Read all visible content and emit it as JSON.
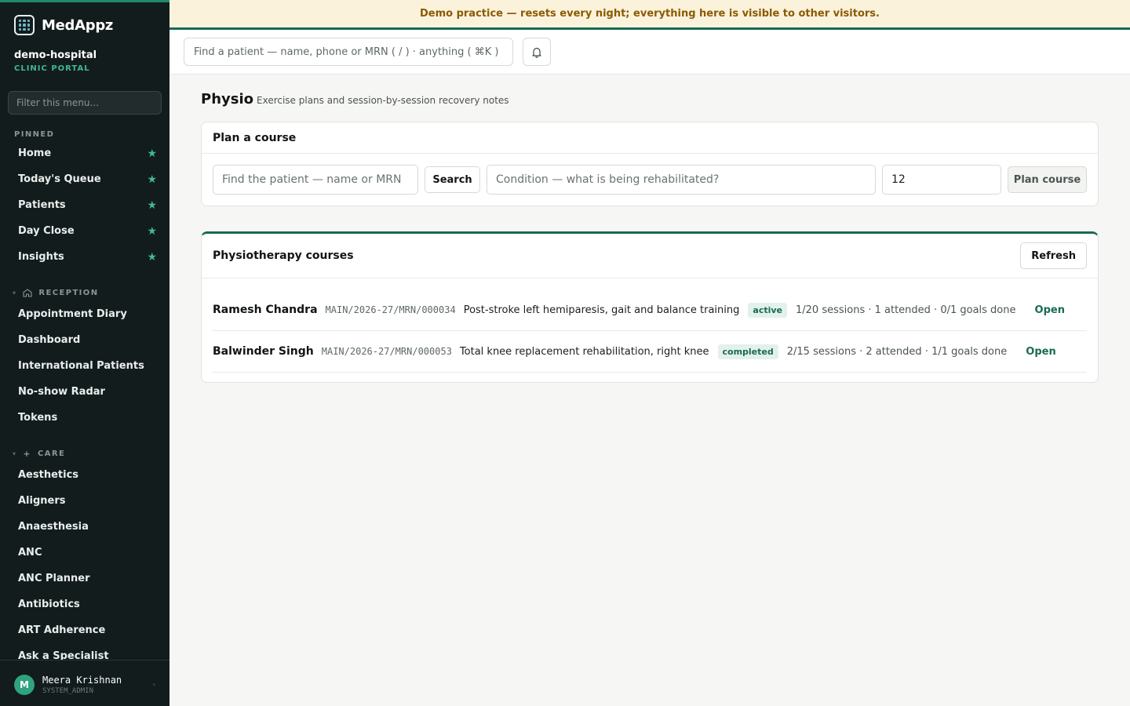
{
  "app": {
    "brand": "MedAppz",
    "org_name": "demo-hospital",
    "org_sub": "CLINIC PORTAL"
  },
  "banner": "Demo practice — resets every night; everything here is visible to other visitors.",
  "sidebar": {
    "filter_placeholder": "Filter this menu...",
    "pinned_title": "PINNED",
    "pinned": [
      {
        "label": "Home"
      },
      {
        "label": "Today's Queue"
      },
      {
        "label": "Patients"
      },
      {
        "label": "Day Close"
      },
      {
        "label": "Insights"
      }
    ],
    "reception_title": "RECEPTION",
    "reception": [
      {
        "label": "Appointment Diary"
      },
      {
        "label": "Dashboard"
      },
      {
        "label": "International Patients"
      },
      {
        "label": "No-show Radar"
      },
      {
        "label": "Tokens"
      }
    ],
    "care_title": "CARE",
    "care": [
      {
        "label": "Aesthetics"
      },
      {
        "label": "Aligners"
      },
      {
        "label": "Anaesthesia"
      },
      {
        "label": "ANC"
      },
      {
        "label": "ANC Planner"
      },
      {
        "label": "Antibiotics"
      },
      {
        "label": "ART Adherence"
      },
      {
        "label": "Ask a Specialist"
      }
    ],
    "pin_icon": "star-icon",
    "accent": "#3fb993"
  },
  "user": {
    "initial": "M",
    "name": "Meera Krishnan",
    "role": "SYSTEM_ADMIN"
  },
  "topbar": {
    "search_placeholder": "Find a patient — name, phone or MRN ( / ) · anything ( ⌘K )",
    "bell_icon": "bell-icon"
  },
  "page": {
    "title": "Physio",
    "subtitle": "Exercise plans and session-by-session recovery notes"
  },
  "plan": {
    "title": "Plan a course",
    "patient_placeholder": "Find the patient — name or MRN",
    "search_label": "Search",
    "condition_placeholder": "Condition — what is being rehabilitated?",
    "sessions_value": "12",
    "plan_label": "Plan course"
  },
  "courses": {
    "title": "Physiotherapy courses",
    "refresh_label": "Refresh",
    "open_label": "Open",
    "rows": [
      {
        "name": "Ramesh Chandra",
        "mrn": "MAIN/2026-27/MRN/000034",
        "condition": "Post-stroke left hemiparesis, gait and balance training",
        "status": "active",
        "stats": "1/20 sessions · 1 attended · 0/1 goals done"
      },
      {
        "name": "Balwinder Singh",
        "mrn": "MAIN/2026-27/MRN/000053",
        "condition": "Total knee replacement rehabilitation, right knee",
        "status": "completed",
        "stats": "2/15 sessions · 2 attended · 1/1 goals done"
      }
    ]
  },
  "colors": {
    "sidebar_bg": "#131c1c",
    "brand_green": "#196a55",
    "banner_bg": "#fbf2dc",
    "banner_text": "#8a5a00"
  }
}
